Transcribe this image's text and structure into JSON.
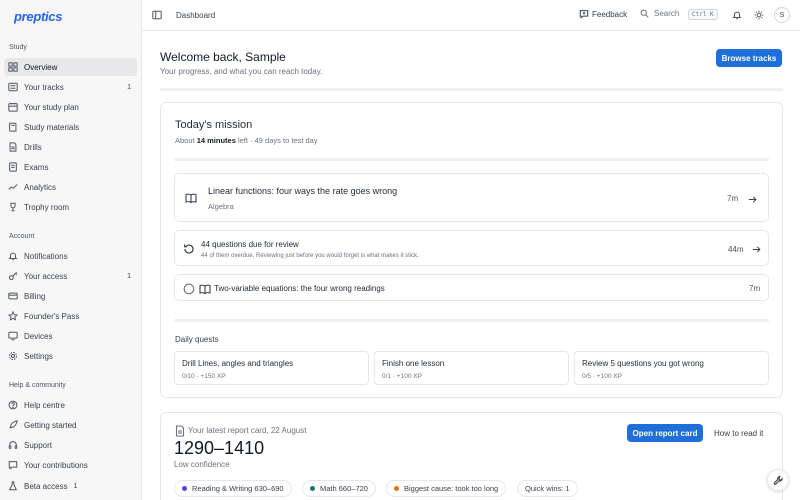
{
  "sidebar": {
    "logo": "preptics",
    "sections": [
      {
        "label": "Study"
      },
      {
        "label": "Account"
      },
      {
        "label": "Help & community"
      }
    ],
    "items": [
      {
        "label": "Overview",
        "icon": "grid-icon",
        "badge": ""
      },
      {
        "label": "Your tracks",
        "icon": "list-icon",
        "badge": "1"
      },
      {
        "label": "Your study plan",
        "icon": "calendar-icon",
        "badge": ""
      },
      {
        "label": "Study materials",
        "icon": "book-icon",
        "badge": ""
      },
      {
        "label": "Drills",
        "icon": "file-icon",
        "badge": ""
      },
      {
        "label": "Exams",
        "icon": "document-icon",
        "badge": ""
      },
      {
        "label": "Analytics",
        "icon": "chart-icon",
        "badge": ""
      },
      {
        "label": "Trophy room",
        "icon": "trophy-icon",
        "badge": ""
      },
      {
        "label": "Notifications",
        "icon": "bell-icon",
        "badge": ""
      },
      {
        "label": "Your access",
        "icon": "key-icon",
        "badge": "1"
      },
      {
        "label": "Billing",
        "icon": "card-icon",
        "badge": ""
      },
      {
        "label": "Founder's Pass",
        "icon": "star-icon",
        "badge": ""
      },
      {
        "label": "Devices",
        "icon": "monitor-icon",
        "badge": ""
      },
      {
        "label": "Settings",
        "icon": "gear-icon",
        "badge": ""
      },
      {
        "label": "Help centre",
        "icon": "help-icon",
        "badge": ""
      },
      {
        "label": "Getting started",
        "icon": "rocket-icon",
        "badge": ""
      },
      {
        "label": "Support",
        "icon": "support-icon",
        "badge": ""
      },
      {
        "label": "Your contributions",
        "icon": "message-icon",
        "badge": ""
      },
      {
        "label": "Beta access",
        "icon": "flask-icon",
        "badge": "1"
      }
    ]
  },
  "topbar": {
    "title": "Dashboard",
    "feedback": "Feedback",
    "search": "Search",
    "shortcut": "Ctrl K",
    "avatar_initial": "S"
  },
  "welcome": {
    "title": "Welcome back, Sample",
    "subtitle": "Your progress, and what you can reach today.",
    "browse_button": "Browse tracks"
  },
  "mission": {
    "title": "Today's mission",
    "sub_prefix": "About ",
    "sub_bold": "14 minutes",
    "sub_suffix": " left · 49 days to test day",
    "rows": [
      {
        "title": "Linear functions: four ways the rate goes wrong",
        "subtitle": "Algebra",
        "time": "7m"
      },
      {
        "title": "44 questions due for review",
        "subtitle": "44 of them overdue. Reviewing just before you would forget is what makes it stick.",
        "time": "44m"
      },
      {
        "title": "Two-variable equations: the four wrong readings",
        "subtitle": "",
        "time": "7m"
      }
    ],
    "quests_label": "Daily quests",
    "quests": [
      {
        "title": "Drill Lines, angles and triangles",
        "progress": "0/10 · +150 XP"
      },
      {
        "title": "Finish one lesson",
        "progress": "0/1 · +100 XP"
      },
      {
        "title": "Review 5 questions you got wrong",
        "progress": "0/5 · +100 XP"
      }
    ]
  },
  "report": {
    "label": "Your latest report card, 22 August",
    "score": "1290–1410",
    "confidence": "Low confidence",
    "open_button": "Open report card",
    "how_link": "How to read it",
    "pills": [
      {
        "label": "Reading & Writing 630–690",
        "color": "#4f46e5"
      },
      {
        "label": "Math 660–720",
        "color": "#0f766e"
      },
      {
        "label": "Biggest cause: took too long",
        "color": "#d97706"
      },
      {
        "label": "Quick wins: 1",
        "color": ""
      }
    ]
  }
}
